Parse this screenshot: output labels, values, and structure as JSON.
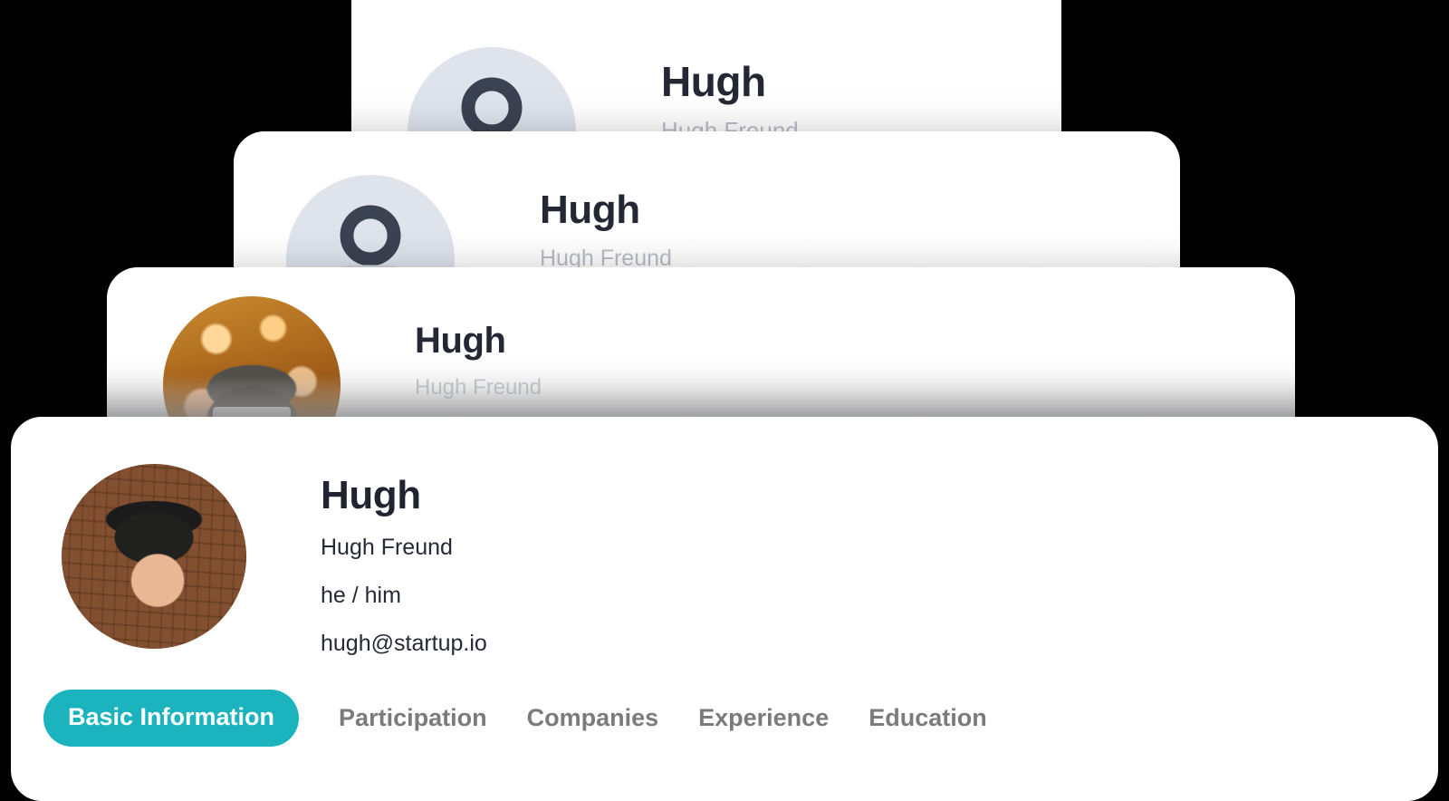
{
  "theme": {
    "page_background": "#000000",
    "card_background": "#ffffff",
    "accent": "#1bb3be",
    "heading_color": "#1f2430",
    "muted_text": "#7b7b7b",
    "ghost_text": "#b9bdc6",
    "avatar_placeholder": "#e7eaf0"
  },
  "profile": {
    "display_name": "Hugh",
    "full_name": "Hugh Freund",
    "pronouns": "he / him",
    "email": "hugh@startup.io"
  },
  "tabs": [
    {
      "label": "Basic Information",
      "active": true
    },
    {
      "label": "Participation",
      "active": false
    },
    {
      "label": "Companies",
      "active": false
    },
    {
      "label": "Experience",
      "active": false
    },
    {
      "label": "Education",
      "active": false
    }
  ],
  "tabs_truncated": [
    {
      "label": "Basic Information",
      "active": true
    },
    {
      "label": "Participation",
      "active": false
    },
    {
      "label": "Compan",
      "active": false
    }
  ],
  "cards": [
    {
      "id": "card-1",
      "avatar_kind": "placeholder-icon",
      "layer": "back"
    },
    {
      "id": "card-2",
      "avatar_kind": "placeholder-icon",
      "layer": "middle"
    },
    {
      "id": "card-3",
      "avatar_kind": "photo-person-back-of-cap",
      "layer": "middle-front"
    },
    {
      "id": "card-4",
      "avatar_kind": "photo-person-portrait",
      "layer": "front"
    }
  ],
  "icons": {
    "avatar_placeholder": "user-avatar-icon"
  }
}
